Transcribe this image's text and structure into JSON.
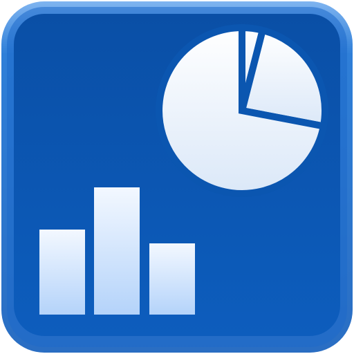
{
  "app_icon": {
    "colors": {
      "frame_outer": "#2a78d2",
      "frame_inner": "#1565c6",
      "tile": "#0b56b0",
      "glyph_light": "#f6f9ff",
      "bar_light": "#e8f2ff",
      "bar_shade": "#b9d6fb"
    },
    "icons": {
      "pie": "pie-chart-icon",
      "bars": "bar-chart-icon"
    },
    "bar_chart": {
      "relative_heights": [
        0.67,
        1.0,
        0.56
      ]
    },
    "pie_chart": {
      "slice_fractions": [
        0.72,
        0.04,
        0.24
      ]
    }
  }
}
